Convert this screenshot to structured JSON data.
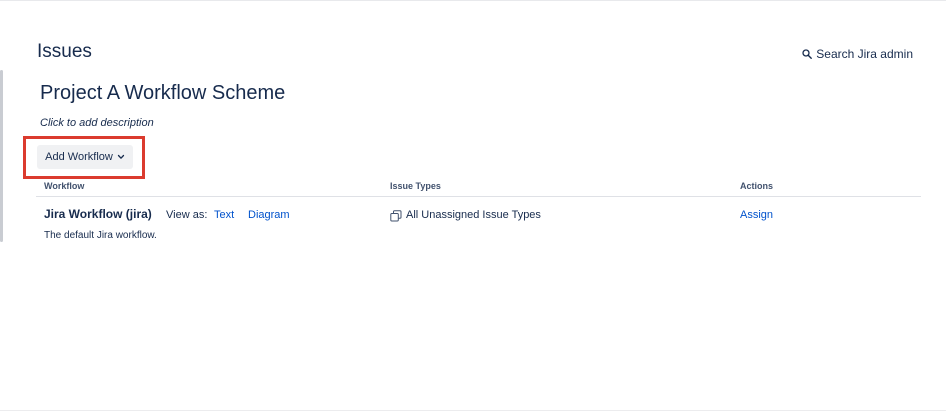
{
  "header": {
    "section_title": "Issues",
    "search_label": "Search Jira admin"
  },
  "scheme": {
    "title": "Project A Workflow Scheme",
    "description_placeholder": "Click to add description"
  },
  "toolbar": {
    "add_workflow_label": "Add Workflow"
  },
  "table": {
    "columns": [
      "Workflow",
      "Issue Types",
      "Actions"
    ],
    "rows": [
      {
        "workflow_name": "Jira Workflow (jira)",
        "view_as_label": "View as:",
        "view_links": [
          "Text",
          "Diagram"
        ],
        "description": "The default Jira workflow.",
        "issue_types": "All Unassigned Issue Types",
        "action": "Assign"
      }
    ]
  },
  "colors": {
    "text": "#172b4d",
    "link": "#0052cc",
    "highlight": "#db3b2e",
    "button_bg": "#f0f1f3"
  }
}
